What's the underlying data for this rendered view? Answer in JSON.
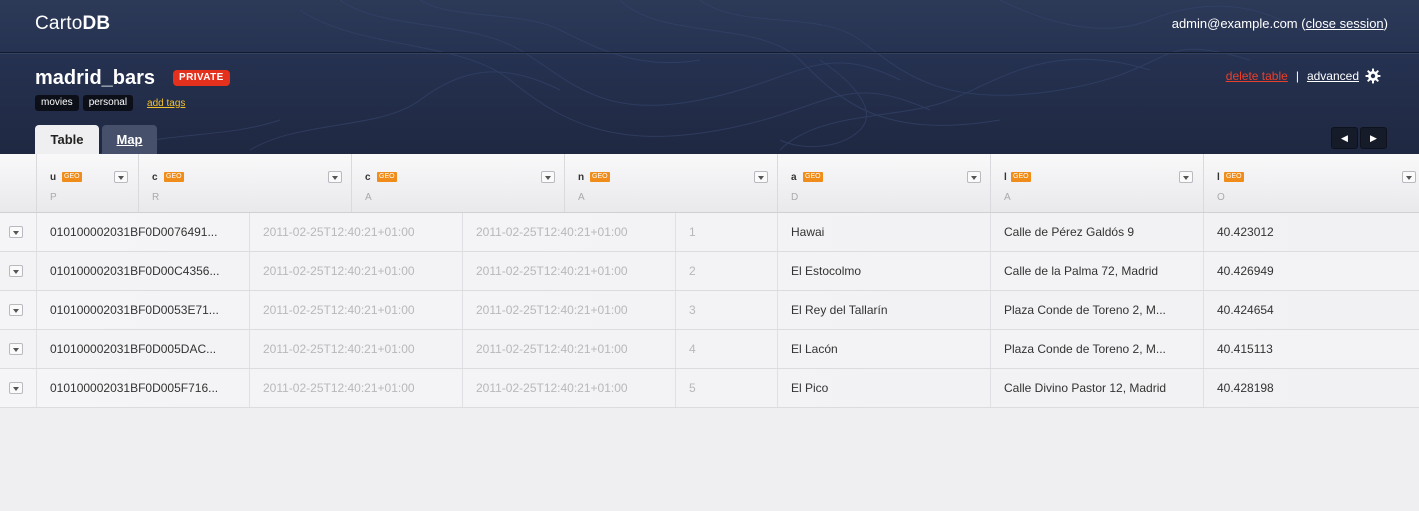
{
  "app": {
    "logo_regular": "Carto",
    "logo_bold": "DB"
  },
  "session": {
    "user": "admin@example.com",
    "open_paren": "(",
    "close_label": "close session",
    "close_paren": ")"
  },
  "table": {
    "name": "madrid_bars",
    "privacy": "PRIVATE"
  },
  "tags": [
    "movies",
    "personal"
  ],
  "add_tags_label": "add tags",
  "actions": {
    "delete_label": "delete table",
    "separator": "|",
    "advanced_label": "advanced"
  },
  "tabs": [
    {
      "label": "Table",
      "active": true
    },
    {
      "label": "Map",
      "active": false
    }
  ],
  "nav": {
    "prev": "◀",
    "next": "▶"
  },
  "columns": [
    {
      "name": "u",
      "badge": "GEO",
      "type": "P"
    },
    {
      "name": "c",
      "badge": "GEO",
      "type": "R"
    },
    {
      "name": "c",
      "badge": "GEO",
      "type": "A"
    },
    {
      "name": "n",
      "badge": "GEO",
      "type": "A"
    },
    {
      "name": "a",
      "badge": "GEO",
      "type": "D"
    },
    {
      "name": "l",
      "badge": "GEO",
      "type": "A"
    },
    {
      "name": "l",
      "badge": "GEO",
      "type": "O"
    }
  ],
  "rows": [
    [
      "010100002031BF0D0076491...",
      "2011-02-25T12:40:21+01:00",
      "2011-02-25T12:40:21+01:00",
      "1",
      "Hawai",
      "Calle de Pérez Galdós 9",
      "40.423012"
    ],
    [
      "010100002031BF0D00C4356...",
      "2011-02-25T12:40:21+01:00",
      "2011-02-25T12:40:21+01:00",
      "2",
      "El Estocolmo",
      "Calle de la Palma 72, Madrid",
      "40.426949"
    ],
    [
      "010100002031BF0D0053E71...",
      "2011-02-25T12:40:21+01:00",
      "2011-02-25T12:40:21+01:00",
      "3",
      "El Rey del Tallarín",
      "Plaza Conde de Toreno 2, M...",
      "40.424654"
    ],
    [
      "010100002031BF0D005DAC...",
      "2011-02-25T12:40:21+01:00",
      "2011-02-25T12:40:21+01:00",
      "4",
      "El Lacón",
      "Plaza Conde de Toreno 2, M...",
      "40.415113"
    ],
    [
      "010100002031BF0D005F716...",
      "2011-02-25T12:40:21+01:00",
      "2011-02-25T12:40:21+01:00",
      "5",
      "El Pico",
      "Calle Divino Pastor 12, Madrid",
      "40.428198"
    ]
  ],
  "colors": {
    "header_bg": "#253150",
    "private_badge": "#e4311d",
    "geo_badge": "#f08c1a",
    "delete_link": "#e8402b",
    "add_tags_link": "#f2c12e"
  }
}
